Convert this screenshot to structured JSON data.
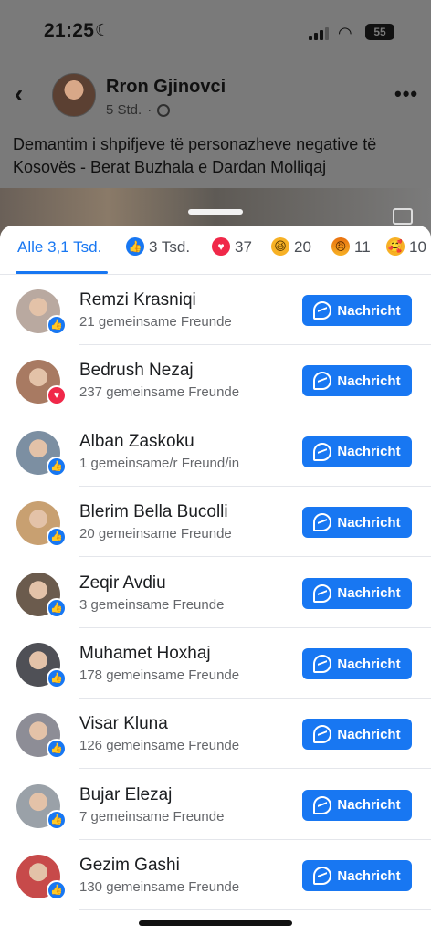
{
  "status_bar": {
    "time": "21:25",
    "battery": "55"
  },
  "post": {
    "author": "Rron Gjinovci",
    "time": "5 Std.",
    "separator": "·",
    "text": "Demantim i shpifjeve të personazheve negative të Kosovës - Berat Buzhala e Dardan Molliqaj"
  },
  "tabs": [
    {
      "label": "Alle 3,1 Tsd.",
      "reaction": null,
      "active": true
    },
    {
      "label": "3 Tsd.",
      "reaction": "like"
    },
    {
      "label": "37",
      "reaction": "love"
    },
    {
      "label": "20",
      "reaction": "haha"
    },
    {
      "label": "11",
      "reaction": "angry"
    },
    {
      "label": "10",
      "reaction": "care"
    }
  ],
  "button_label": "Nachricht",
  "people": [
    {
      "name": "Remzi Krasniqi",
      "mutual": "21 gemeinsame Freunde",
      "reaction": "like",
      "avatar_color": "#b9a9a0"
    },
    {
      "name": "Bedrush Nezaj",
      "mutual": "237 gemeinsame Freunde",
      "reaction": "love",
      "avatar_color": "#a87a62"
    },
    {
      "name": "Alban Zaskoku",
      "mutual": "1 gemeinsame/r Freund/in",
      "reaction": "like",
      "avatar_color": "#7c8fa2"
    },
    {
      "name": "Blerim Bella Bucolli",
      "mutual": "20 gemeinsame Freunde",
      "reaction": "like",
      "avatar_color": "#c8a071"
    },
    {
      "name": "Zeqir Avdiu",
      "mutual": "3 gemeinsame Freunde",
      "reaction": "like",
      "avatar_color": "#6b5b4d"
    },
    {
      "name": "Muhamet Hoxhaj",
      "mutual": "178 gemeinsame Freunde",
      "reaction": "like",
      "avatar_color": "#4f5056"
    },
    {
      "name": "Visar Kluna",
      "mutual": "126 gemeinsame Freunde",
      "reaction": "like",
      "avatar_color": "#8d8d96"
    },
    {
      "name": "Bujar Elezaj",
      "mutual": "7 gemeinsame Freunde",
      "reaction": "like",
      "avatar_color": "#9aa1a8"
    },
    {
      "name": "Gezim Gashi",
      "mutual": "130 gemeinsame Freunde",
      "reaction": "like",
      "avatar_color": "#c74a4a"
    }
  ],
  "colors": {
    "accent": "#1877f2",
    "love": "#f02849",
    "text_secondary": "#65676b"
  },
  "icons": {
    "back": "chevron-left-icon",
    "more": "more-horizontal-icon",
    "privacy": "globe-icon",
    "button": "messenger-icon"
  }
}
